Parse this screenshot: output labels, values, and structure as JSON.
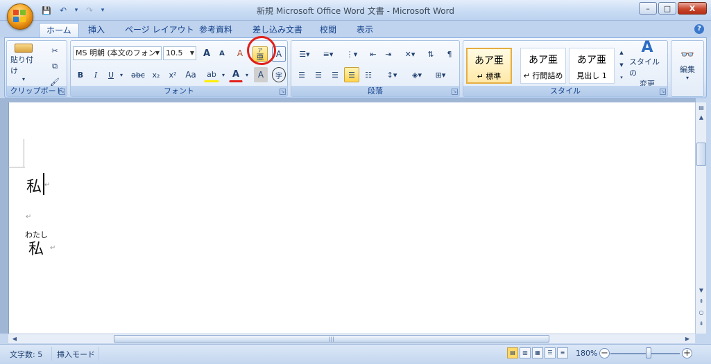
{
  "window": {
    "title": "新規 Microsoft Office Word 文書 - Microsoft Word",
    "min": "–",
    "max": "□",
    "close": "X"
  },
  "qat": {
    "save": "💾",
    "undo": "↶",
    "undo_arrow": "▾",
    "redo": "↷",
    "customize": "▾"
  },
  "tabs": [
    "ホーム",
    "挿入",
    "ページ レイアウト",
    "参考資料",
    "差し込み文書",
    "校閲",
    "表示"
  ],
  "help": "?",
  "ribbon": {
    "clipboard": {
      "label": "クリップボード",
      "paste": "貼り付け",
      "paste_arrow": "▾"
    },
    "font": {
      "label": "フォント",
      "font_name": "MS 明朝 (本文のフォン",
      "font_size": "10.5",
      "grow": "A",
      "shrink": "A",
      "clear": "A",
      "ruby_top": "ア",
      "ruby_bottom": "亜",
      "border_char": "A",
      "bold": "B",
      "italic": "I",
      "underline": "U",
      "strike": "abc",
      "sub": "x₂",
      "sup": "x²",
      "case": "Aa",
      "highlight": "ab",
      "font_color": "A",
      "shade": "A",
      "enclose": "字"
    },
    "paragraph": {
      "label": "段落"
    },
    "styles": {
      "label": "スタイル",
      "items": [
        {
          "sample": "あア亜",
          "name": "↵ 標準"
        },
        {
          "sample": "あア亜",
          "name": "↵ 行間詰め"
        },
        {
          "sample": "あア亜",
          "name": "見出し 1"
        }
      ],
      "change": "スタイルの\n変更",
      "change_line1": "スタイルの",
      "change_line2": "変更"
    },
    "editing": {
      "label": "編集"
    }
  },
  "document": {
    "line1": "私",
    "ruby_reading": "わたし",
    "ruby_base": "私",
    "pilcrow": "↵"
  },
  "status": {
    "char_count": "文字数: 5",
    "mode": "挿入モード",
    "zoom": "180%",
    "zoom_minus": "−",
    "zoom_plus": "+"
  },
  "colors": {
    "accent": "#15428b",
    "highlight_circle": "#e1201a",
    "selected_style": "#e6ad41"
  }
}
